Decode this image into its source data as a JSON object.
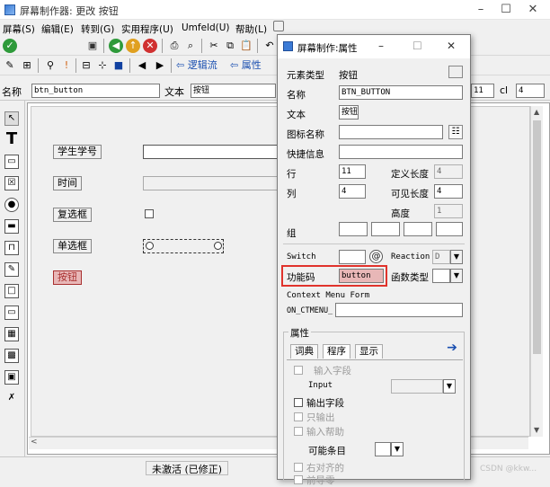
{
  "window": {
    "title": "屏幕制作器:   更改 按钮",
    "controls": {
      "minimize": "–",
      "maximize": "☐",
      "close": "✕"
    }
  },
  "menu": [
    "屏幕(S)",
    "编辑(E)",
    "转到(G)",
    "实用程序(U)",
    "Umfeld(U)",
    "帮助(L)"
  ],
  "toolbar2": {
    "buttons": [
      "逻辑流",
      "属性"
    ]
  },
  "propline": {
    "name_label": "名称",
    "name_value": "btn_button",
    "text_label": "文本",
    "text_value": "按钮",
    "col_value": "11",
    "cl_label": "cl",
    "cl_value": "4"
  },
  "canvas": {
    "labels": [
      "学生学号",
      "时间",
      "复选框",
      "单选框"
    ],
    "button_label": "按钮"
  },
  "status": {
    "text": "未激活 (已修正)",
    "watermark": "CSDN @kkw..."
  },
  "dialog": {
    "title": "屏幕制作:属性",
    "controls": {
      "minimize": "–",
      "maximize": "☐",
      "close": "✕"
    },
    "element_type_label": "元素类型",
    "element_type_value": "按钮",
    "name_label": "名称",
    "name_value": "BTN_BUTTON",
    "text_label": "文本",
    "text_value": "按钮",
    "icon_label": "图标名称",
    "icon_value": "",
    "quickinfo_label": "快捷信息",
    "quickinfo_value": "",
    "row_label": "行",
    "row_value": "11",
    "deflen_label": "定义长度",
    "deflen_value": "4",
    "col_label": "列",
    "col_value": "4",
    "vislen_label": "可见长度",
    "vislen_value": "4",
    "height_label": "高度",
    "height_value": "1",
    "group_label": "组",
    "switch_label": "Switch",
    "reaction_label": "Reaction",
    "reaction_value": "D",
    "fcode_label": "功能码",
    "fcode_value": "button",
    "ftype_label": "函数类型",
    "ctx_label": "Context Menu Form",
    "ctx_prefix": "ON_CTMENU_",
    "attr_group": "属性",
    "tabs": [
      "词典",
      "程序",
      "显示"
    ],
    "input_field": "输入字段",
    "input_label": "Input",
    "output_field": "输出字段",
    "output_only": "只输出",
    "input_help": "输入帮助",
    "possible_entry": "可能条目",
    "right_aligned": "右对齐的",
    "leading_zero": "前导零"
  },
  "colors": {
    "highlight_red": "#e0332c",
    "button_bg": "#e8b7b7",
    "button_text": "#a83030"
  }
}
